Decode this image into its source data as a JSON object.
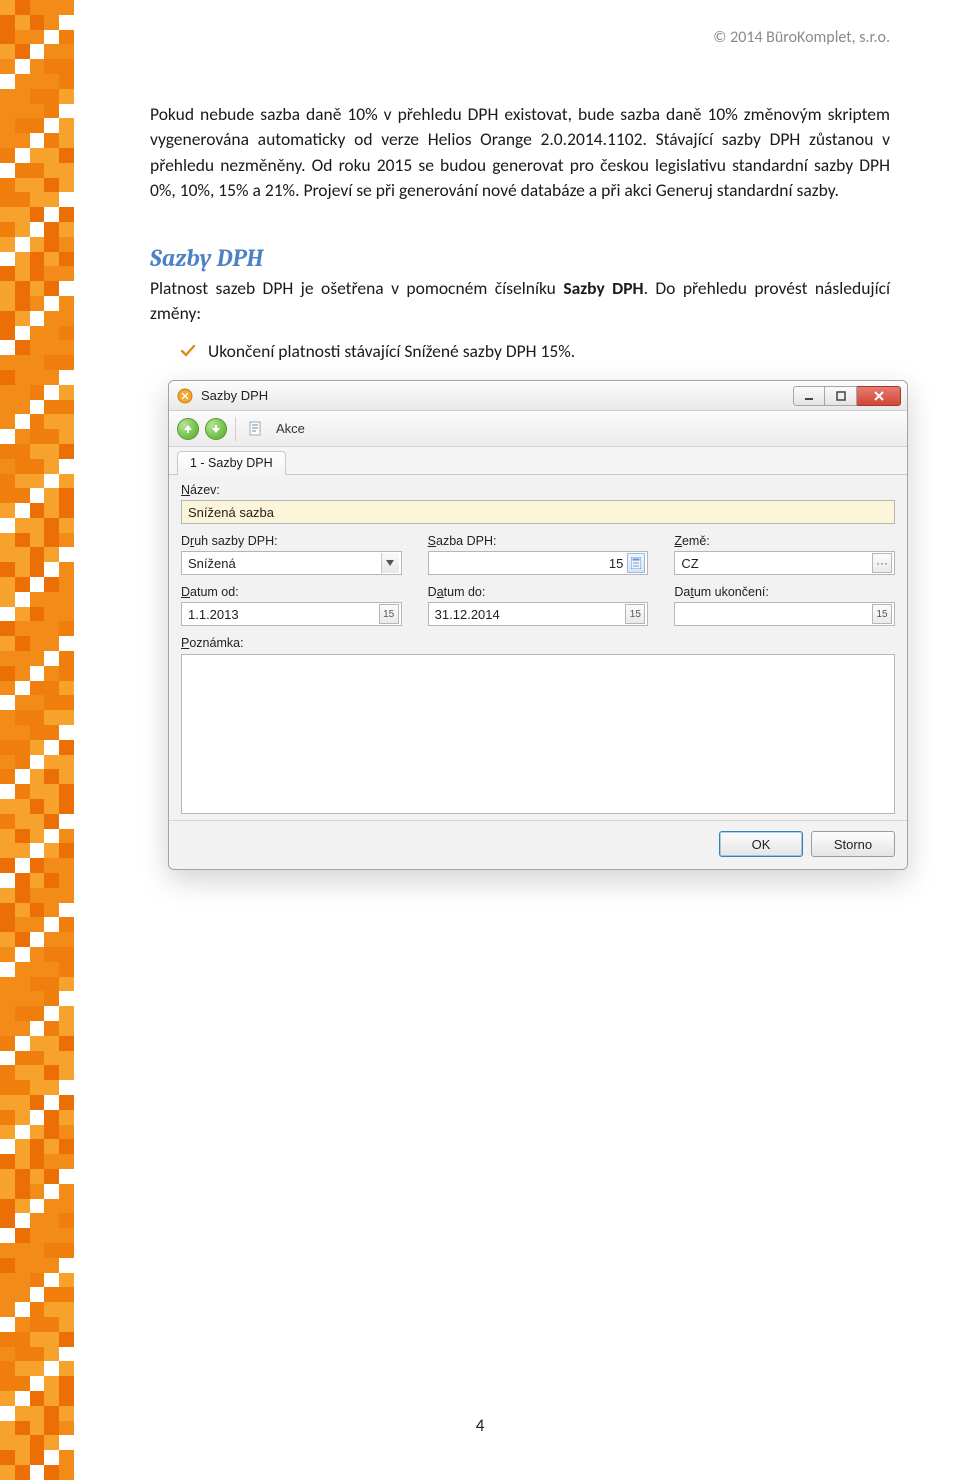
{
  "copyright": "© 2014 BüroKomplet, s.r.o.",
  "paragraph_1": "Pokud nebude sazba daně 10% v přehledu DPH existovat, bude sazba daně 10% změnovým skriptem vygenerována automaticky od verze Helios Orange 2.0.2014.1102. Stávající sazby DPH zůstanou v přehledu nezměněny. Od roku 2015 se budou generovat pro českou legislativu standardní sazby DPH 0%, 10%, 15% a 21%. Projeví se při generování nové databáze a při akci Generuj standardní sazby.",
  "section_title": "Sazby DPH",
  "paragraph_2a": "Platnost sazeb DPH je ošetřena v pomocném číselníku ",
  "paragraph_2b_bold": "Sazby DPH",
  "paragraph_2c": ". Do přehledu provést následující změny:",
  "bullet_1": "Ukončení platnosti stávající Snížené sazby DPH 15%.",
  "dialog": {
    "title": "Sazby DPH",
    "toolbar_action": "Akce",
    "tab_label": "1 - Sazby DPH",
    "labels": {
      "nazev": "Název:",
      "druh": "Druh sazby DPH:",
      "sazba": "Sazba DPH:",
      "zeme": "Země:",
      "datum_od": "Datum od:",
      "datum_do": "Datum do:",
      "datum_ukonceni": "Datum ukončení:",
      "poznamka": "Poznámka:"
    },
    "values": {
      "nazev": "Snížená sazba",
      "druh": "Snížená",
      "sazba": "15",
      "zeme": "CZ",
      "datum_od": "1.1.2013",
      "datum_do": "31.12.2014",
      "datum_ukonceni": ""
    },
    "buttons": {
      "ok": "OK",
      "storno": "Storno"
    }
  },
  "page_number": "4"
}
